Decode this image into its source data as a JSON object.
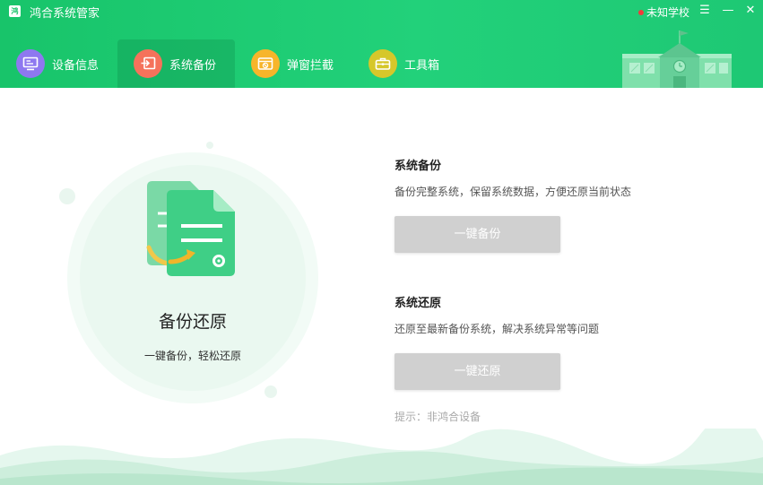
{
  "app": {
    "logo_text": "鸿",
    "title": "鸿合系统管家"
  },
  "titlebar": {
    "school_name": "未知学校",
    "menu_glyph": "☰",
    "minimize_glyph": "—",
    "close_glyph": "✕"
  },
  "tabs": [
    {
      "label": "设备信息",
      "icon": "monitor-icon",
      "color": "#8e78f0",
      "active": false
    },
    {
      "label": "系统备份",
      "icon": "backup-icon",
      "color": "#f5725b",
      "active": true
    },
    {
      "label": "弹窗拦截",
      "icon": "popup-block-icon",
      "color": "#f7b52a",
      "active": false
    },
    {
      "label": "工具箱",
      "icon": "toolbox-icon",
      "color": "#d6c72a",
      "active": false
    }
  ],
  "left_panel": {
    "title": "备份还原",
    "subtitle": "一键备份，轻松还原"
  },
  "backup": {
    "heading": "系统备份",
    "description": "备份完整系统，保留系统数据，方便还原当前状态",
    "button": "一键备份"
  },
  "restore": {
    "heading": "系统还原",
    "description": "还原至最新备份系统，解决系统异常等问题",
    "button": "一键还原"
  },
  "hint": "提示：非鸿合设备",
  "colors": {
    "header_green": "#1ec874",
    "button_disabled": "#d0d0d0",
    "accent_green": "#3fcf86"
  }
}
